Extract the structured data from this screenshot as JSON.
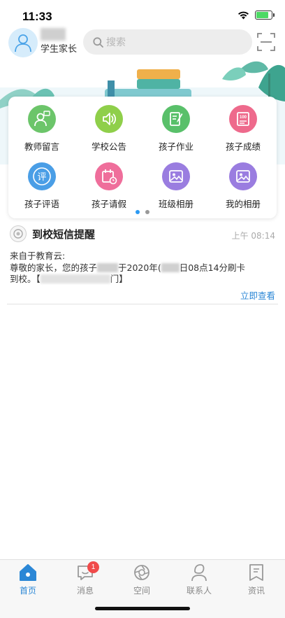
{
  "status_bar": {
    "time": "11:33",
    "battery_level": 0.8,
    "battery_color": "#4cd964"
  },
  "header": {
    "user_role": "学生家长",
    "search_placeholder": "搜索",
    "avatar_color": "#d6ecfb"
  },
  "grid": {
    "items": [
      {
        "label": "教师留言",
        "icon": "teacher-message-icon",
        "color": "#6cc56a"
      },
      {
        "label": "学校公告",
        "icon": "speaker-icon",
        "color": "#8fcf4a"
      },
      {
        "label": "孩子作业",
        "icon": "homework-icon",
        "color": "#59c06a"
      },
      {
        "label": "孩子成绩",
        "icon": "grades-icon",
        "color": "#ee6a8c"
      },
      {
        "label": "孩子评语",
        "icon": "comment-icon",
        "color": "#4a9ee6"
      },
      {
        "label": "孩子请假",
        "icon": "calendar-icon",
        "color": "#ef6e9b"
      },
      {
        "label": "班级相册",
        "icon": "album-icon",
        "color": "#9a7de0"
      },
      {
        "label": "我的相册",
        "icon": "album-icon",
        "color": "#9a7de0"
      }
    ],
    "comment_glyph": "评",
    "page_count": 2,
    "active_page": 1
  },
  "message": {
    "title": "到校短信提醒",
    "time": "上午 08:14",
    "line1": "来自于教育云:",
    "line2_a": "尊敬的家长，您的孩子",
    "line2_b": "于2020年(",
    "line2_c": "日08点14分刷卡",
    "line3_a": "到校。【",
    "line3_b": "门】",
    "link": "立即查看"
  },
  "tabbar": {
    "items": [
      {
        "label": "首页",
        "icon": "home-icon",
        "active": true
      },
      {
        "label": "消息",
        "icon": "chat-icon",
        "badge": "1"
      },
      {
        "label": "空间",
        "icon": "aperture-icon"
      },
      {
        "label": "联系人",
        "icon": "contact-icon"
      },
      {
        "label": "资讯",
        "icon": "news-icon"
      }
    ],
    "active_color": "#2b87d6",
    "inactive_color": "#999999"
  }
}
